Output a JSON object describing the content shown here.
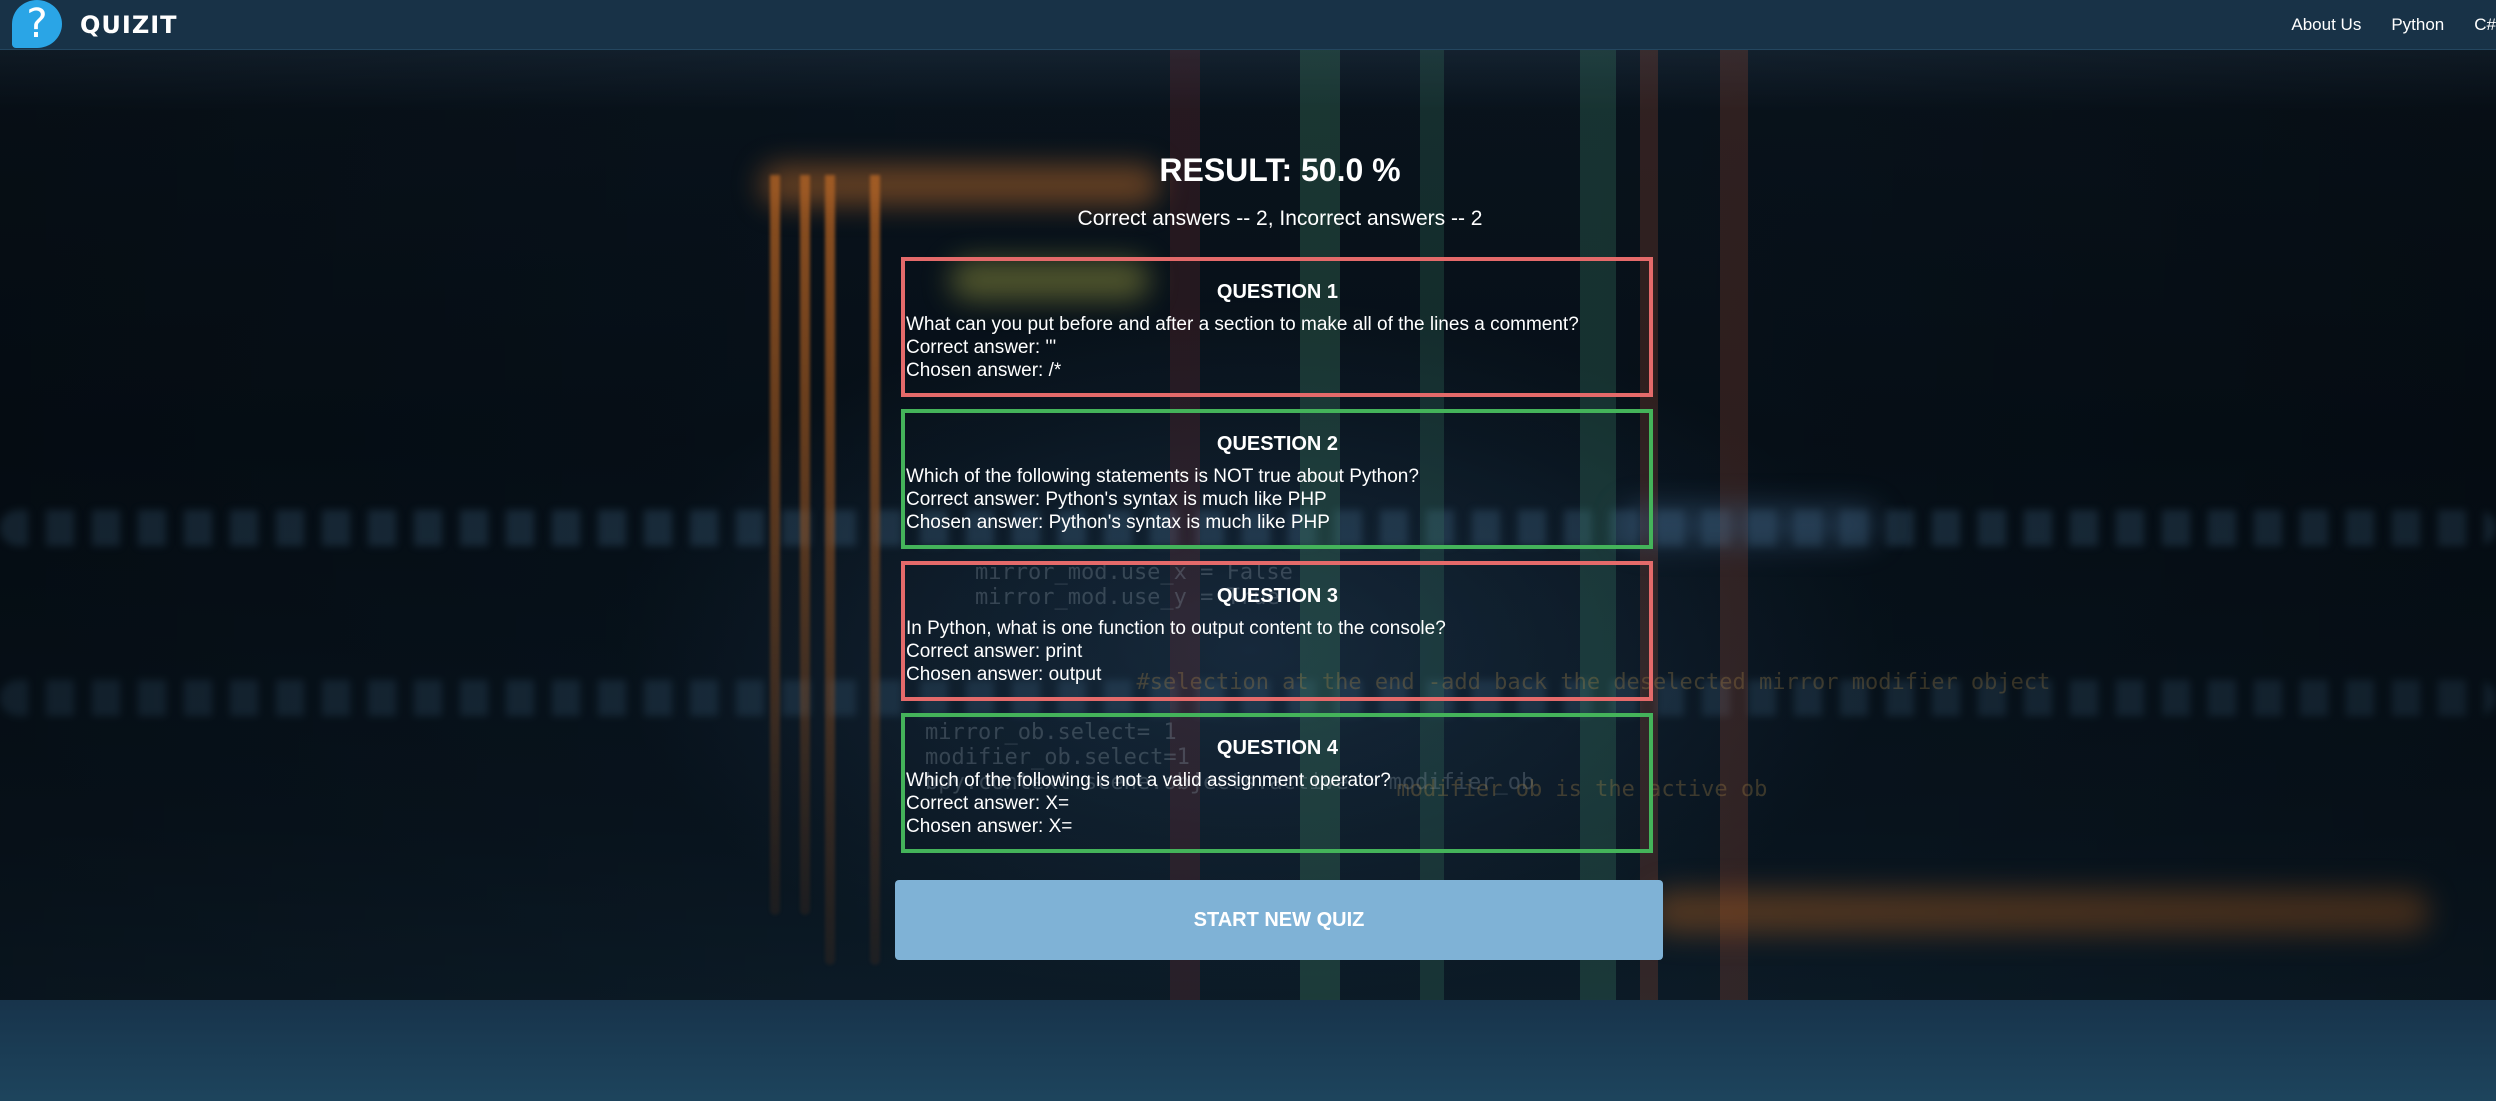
{
  "app": {
    "brand": "QUIZIT",
    "logo_icon": "question-mark-icon"
  },
  "nav": {
    "links": [
      "About Us",
      "Python",
      "C#"
    ]
  },
  "result": {
    "title": "RESULT: 50.0 %",
    "summary": "Correct answers -- 2, Incorrect answers -- 2"
  },
  "questions": [
    {
      "title": "QUESTION 1",
      "status": "incorrect",
      "text": "What can you put before and after a section to make all of the lines a comment?",
      "correct": "Correct answer: '''",
      "chosen": "Chosen answer: /*"
    },
    {
      "title": "QUESTION 2",
      "status": "correct",
      "text": "Which of the following statements is NOT true about Python?",
      "correct": "Correct answer: Python's syntax is much like PHP",
      "chosen": "Chosen answer: Python's syntax is much like PHP"
    },
    {
      "title": "QUESTION 3",
      "status": "incorrect",
      "text": "In Python, what is one function to output content to the console?",
      "correct": "Correct answer: print",
      "chosen": "Chosen answer: output"
    },
    {
      "title": "QUESTION 4",
      "status": "correct",
      "text": "Which of the following is not a valid assignment operator?",
      "correct": "Correct answer: X=",
      "chosen": "Chosen answer: X="
    }
  ],
  "actions": {
    "start_new_quiz": "START NEW QUIZ"
  },
  "colors": {
    "navbar": "#183247",
    "correct_border": "#44b35a",
    "incorrect_border": "#e46a6a",
    "button": "#7fb2d6",
    "logo": "#2aa5e6"
  }
}
